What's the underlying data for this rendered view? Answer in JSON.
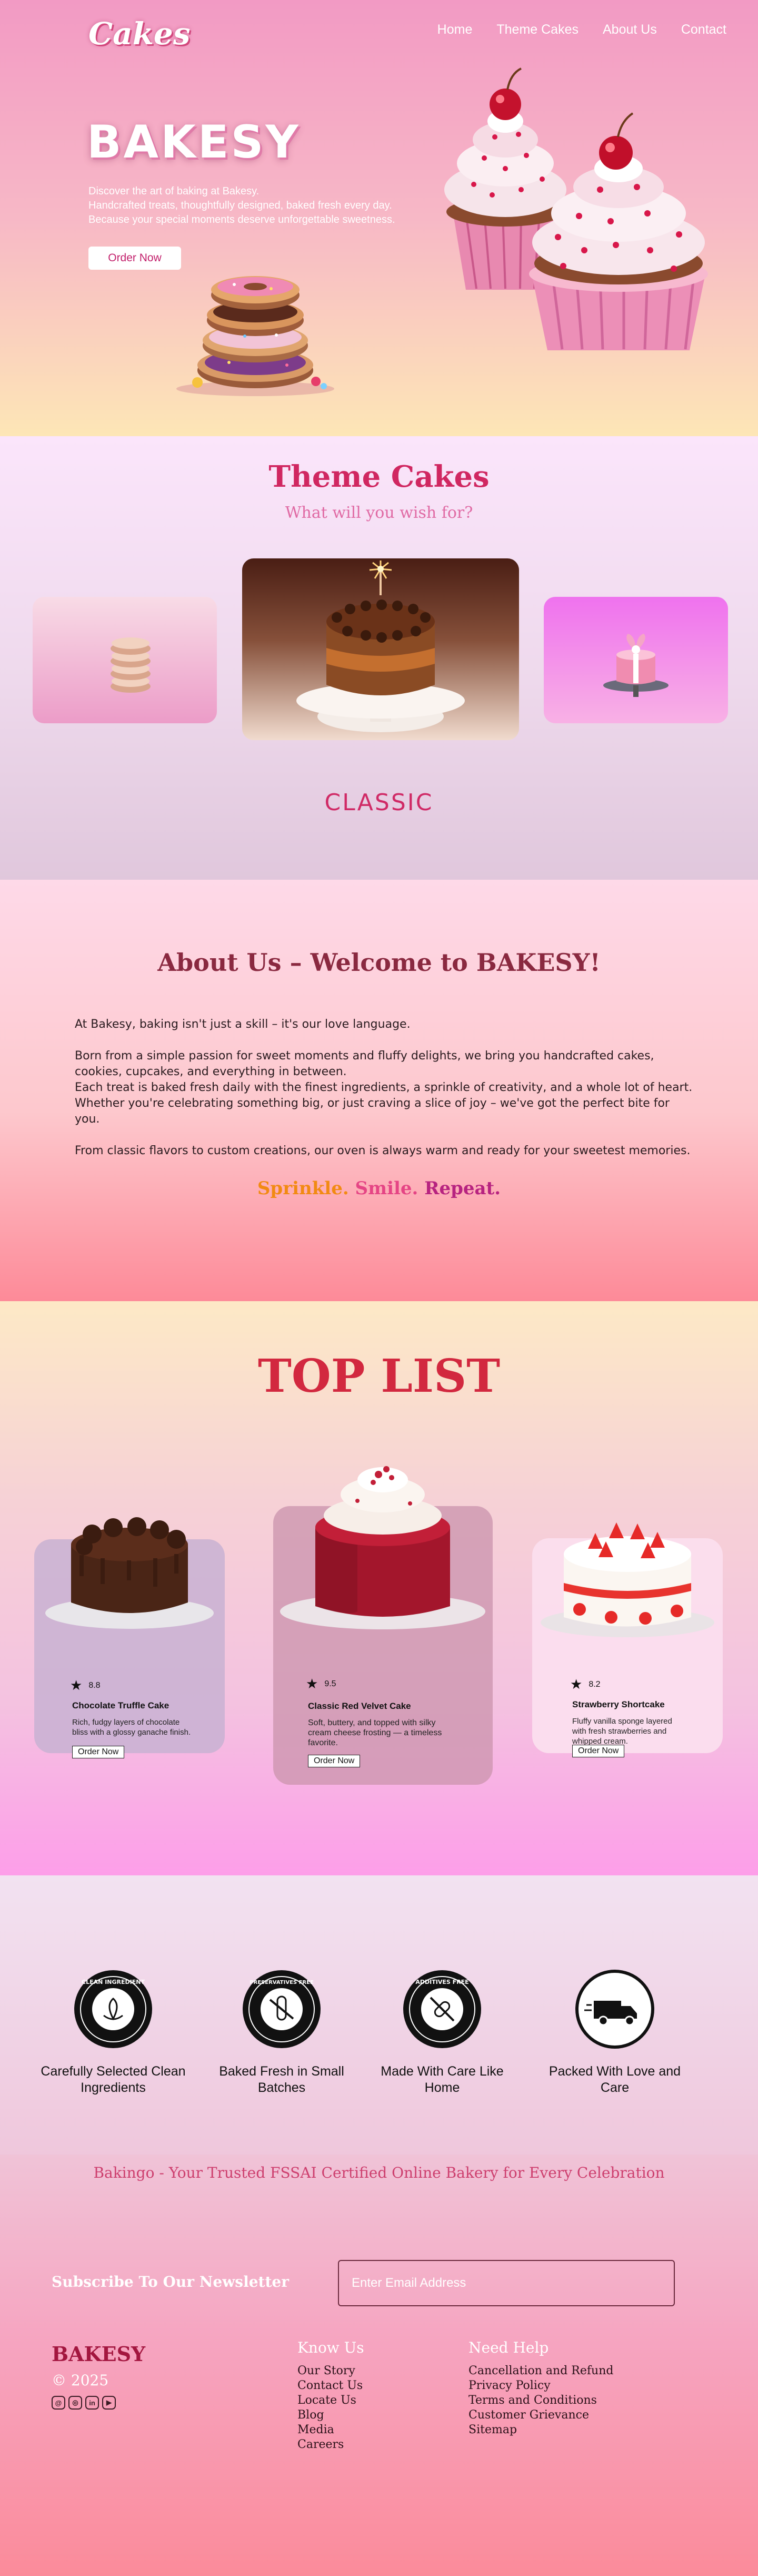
{
  "header": {
    "logo": "Cakes",
    "nav": [
      "Home",
      "Theme Cakes",
      "About Us",
      "Contact"
    ]
  },
  "hero": {
    "title": "BAKESY",
    "desc": [
      "Discover the art of baking at Bakesy.",
      "Handcrafted treats, thoughtfully designed, baked fresh every day.",
      "Because your special moments deserve unforgettable sweetness."
    ],
    "cta": "Order Now"
  },
  "theme": {
    "title": "Theme Cakes",
    "subtitle": "What will you wish for?",
    "active_label": "CLASSIC"
  },
  "about": {
    "title": "About Us – Welcome to BAKESY!",
    "p1": "At Bakesy, baking isn't just a skill – it's our love language.",
    "p2a": "Born from a simple passion for sweet moments and fluffy delights, we bring you handcrafted cakes, cookies, cupcakes, and everything in between.",
    "p2b": "Each treat is baked fresh daily with the finest ingredients, a sprinkle of creativity, and a whole lot of heart.",
    "p2c": "Whether you're celebrating something big, or just craving a slice of joy – we've got the perfect bite for you.",
    "p3": "From classic flavors to custom creations, our oven is always warm and ready for your sweetest memories.",
    "tag_a": "Sprinkle.",
    "tag_b": "Smile.",
    "tag_c": "Repeat."
  },
  "toplist": {
    "title": "TOP LIST",
    "products": [
      {
        "rating": "8.8",
        "name": "Chocolate Truffle Cake",
        "desc": "Rich, fudgy layers of chocolate bliss with a glossy ganache finish.",
        "cta": "Order Now"
      },
      {
        "rating": "9.5",
        "name": "Classic Red Velvet Cake",
        "desc": "Soft, buttery, and topped with silky cream cheese frosting — a timeless favorite.",
        "cta": "Order Now"
      },
      {
        "rating": "8.2",
        "name": "Strawberry Shortcake",
        "desc": "Fluffy vanilla sponge layered with fresh strawberries and whipped cream.",
        "cta": "Order Now"
      }
    ]
  },
  "features": {
    "items": [
      {
        "caption": "Carefully Selected Clean Ingredients",
        "badge_text": "CLEAN INGREDIENT"
      },
      {
        "caption": "Baked Fresh in Small Batches",
        "badge_text": "PRESERVATIVES FREE"
      },
      {
        "caption": "Made With Care Like Home",
        "badge_text": "ADDITIVES FREE"
      },
      {
        "caption": "Packed With Love and Care",
        "badge_text": ""
      }
    ],
    "fssai": "Bakingo - Your Trusted FSSAI Certified Online Bakery for Every Celebration"
  },
  "footer": {
    "newsletter_label": "Subscribe To Our Newsletter",
    "email_placeholder": "Enter Email Address",
    "brand": "BAKESY",
    "copyright": "© 2025",
    "know_us": {
      "title": "Know Us",
      "links": [
        "Our Story",
        "Contact Us",
        "Locate Us",
        "Blog",
        "Media",
        "Careers"
      ]
    },
    "need_help": {
      "title": "Need Help",
      "links": [
        "Cancellation and Refund",
        "Privacy Policy",
        "Terms and Conditions",
        "Customer Grievance",
        "Sitemap"
      ]
    },
    "social_icons": [
      "threads-icon",
      "instagram-icon",
      "linkedin-icon",
      "youtube-icon"
    ]
  },
  "colors": {
    "accent": "#d02761",
    "brand": "#a3163f"
  }
}
